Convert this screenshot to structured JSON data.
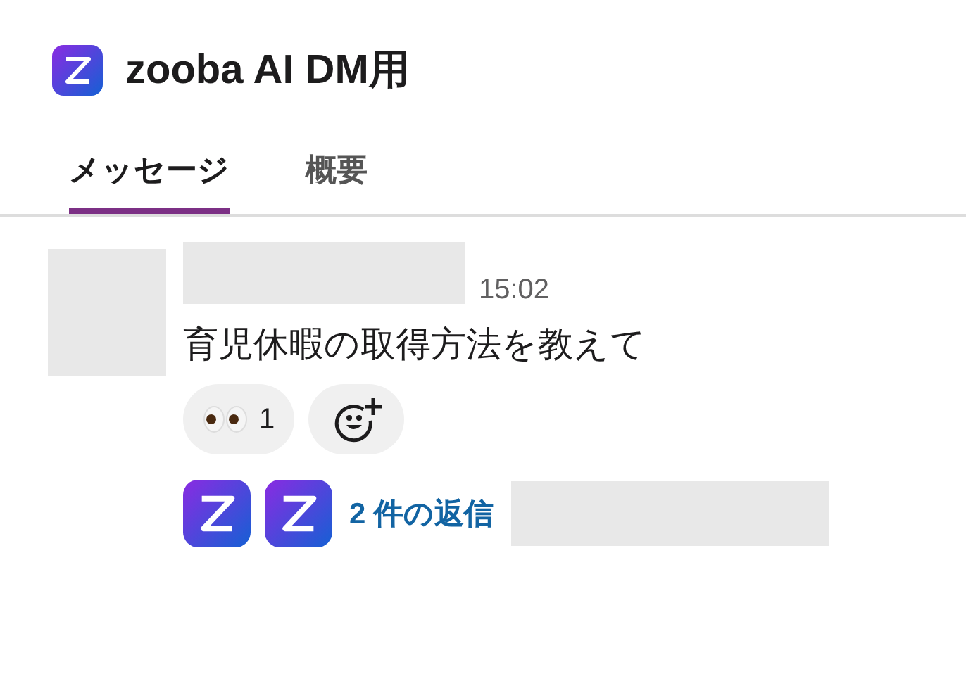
{
  "header": {
    "title": "zooba AI DM用"
  },
  "tabs": [
    {
      "label": "メッセージ",
      "selected": true
    },
    {
      "label": "概要",
      "selected": false
    }
  ],
  "message": {
    "time": "15:02",
    "text": "育児休暇の取得方法を教えて",
    "reactions": [
      {
        "kind": "eyes",
        "count": "1"
      },
      {
        "kind": "add"
      }
    ],
    "replies": {
      "avatars": [
        {
          "kind": "app-logo"
        },
        {
          "kind": "app-logo"
        }
      ],
      "label": "2 件の返信"
    }
  }
}
